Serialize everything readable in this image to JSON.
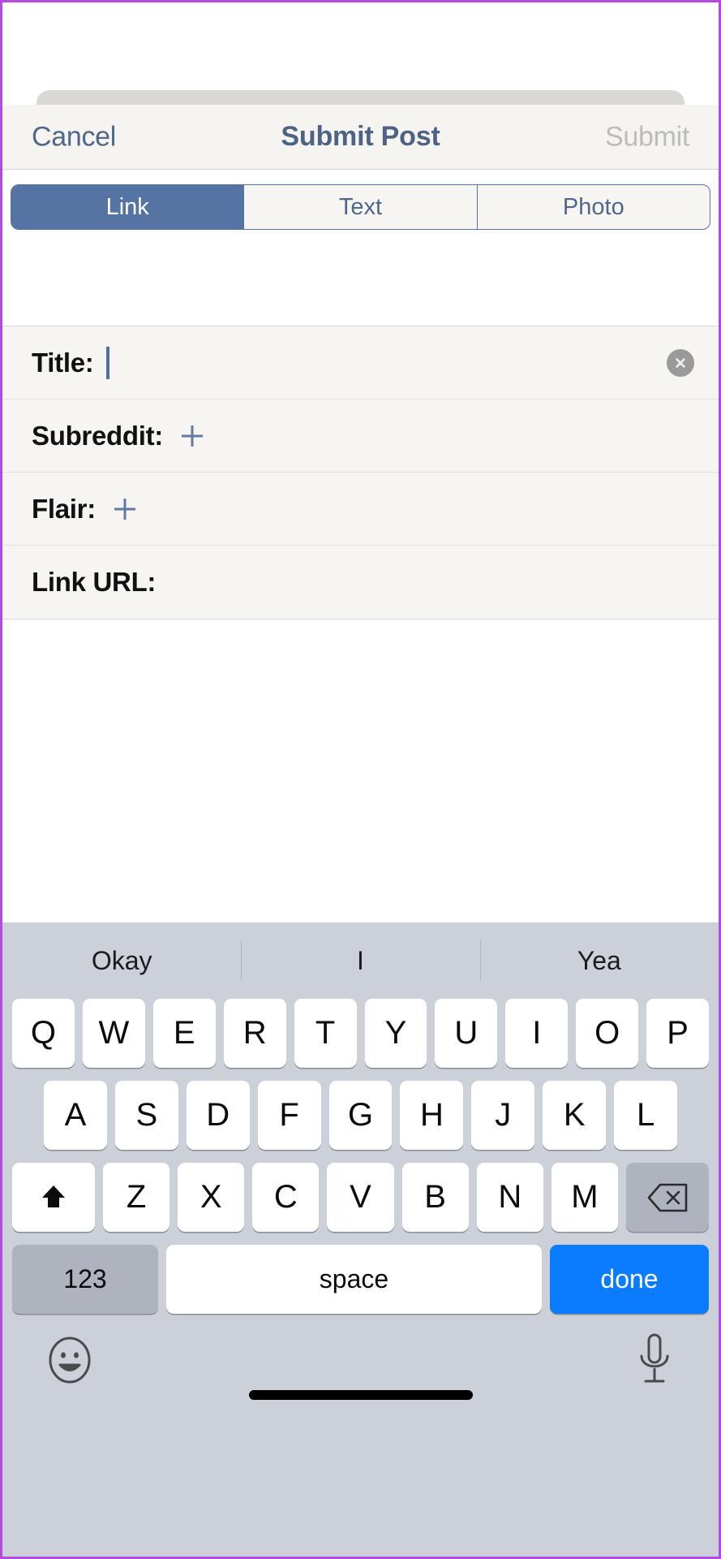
{
  "navbar": {
    "cancel_label": "Cancel",
    "title": "Submit Post",
    "submit_label": "Submit",
    "submit_disabled": true,
    "cancel_color": "#4f6789",
    "title_color": "#4c6384",
    "submit_color": "#bcbcbc",
    "background": "#f6f4f1"
  },
  "segmented_control": {
    "selected_index": 0,
    "accent_color": "#5574a3",
    "items": [
      {
        "label": "Link",
        "selected": true
      },
      {
        "label": "Text",
        "selected": false
      },
      {
        "label": "Photo",
        "selected": false
      }
    ]
  },
  "form": {
    "background": "#f7f5f2",
    "fields": [
      {
        "label": "Title:",
        "value": "",
        "placeholder": "",
        "accessory": "caret",
        "has_clear_button": true
      },
      {
        "label": "Subreddit:",
        "value": "",
        "placeholder": "",
        "accessory": "plus-icon",
        "has_clear_button": false
      },
      {
        "label": "Flair:",
        "value": "",
        "placeholder": "",
        "accessory": "plus-icon",
        "has_clear_button": false
      },
      {
        "label": "Link URL:",
        "value": "",
        "placeholder": "",
        "accessory": "none",
        "has_clear_button": false
      }
    ],
    "clear_icon": "close-circle-icon",
    "plus_icon": "plus-icon",
    "plus_color": "#5e7aa5",
    "caret_color": "#4a6ea8"
  },
  "keyboard": {
    "background": "#ccd0d9",
    "predictive_suggestions": [
      "Okay",
      "I",
      "Yea"
    ],
    "row1": [
      "Q",
      "W",
      "E",
      "R",
      "T",
      "Y",
      "U",
      "I",
      "O",
      "P"
    ],
    "row2": [
      "A",
      "S",
      "D",
      "F",
      "G",
      "H",
      "J",
      "K",
      "L"
    ],
    "row3_letters": [
      "Z",
      "X",
      "C",
      "V",
      "B",
      "N",
      "M"
    ],
    "shift_icon": "shift-arrow-icon",
    "backspace_icon": "backspace-icon",
    "numbers_label": "123",
    "space_label": "space",
    "return_label": "done",
    "return_color": "#0a7cff",
    "emoji_icon": "emoji-smiley-icon",
    "mic_icon": "microphone-icon"
  }
}
